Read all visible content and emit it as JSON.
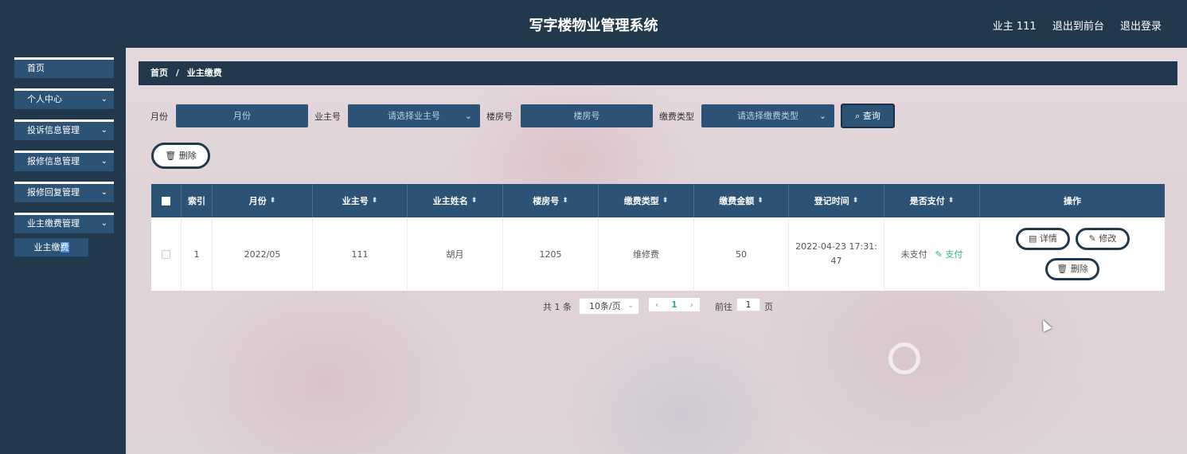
{
  "header": {
    "title": "写字楼物业管理系统",
    "user": "业主 111",
    "to_front": "退出到前台",
    "logout": "退出登录"
  },
  "sidebar": {
    "items": [
      {
        "label": "首页",
        "has_chevron": false
      },
      {
        "label": "个人中心",
        "has_chevron": true
      },
      {
        "label": "投诉信息管理",
        "has_chevron": true
      },
      {
        "label": "报修信息管理",
        "has_chevron": true
      },
      {
        "label": "报修回复管理",
        "has_chevron": true
      },
      {
        "label": "业主缴费管理",
        "has_chevron": true
      }
    ],
    "sub_item_a": "业主缴",
    "sub_item_b": "费"
  },
  "breadcrumb": {
    "home": "首页",
    "sep": "/",
    "current": "业主缴费"
  },
  "search": {
    "month_label": "月份",
    "month_placeholder": "月份",
    "owner_label": "业主号",
    "owner_placeholder": "请选择业主号",
    "room_label": "楼房号",
    "room_placeholder": "楼房号",
    "type_label": "缴费类型",
    "type_placeholder": "请选择缴费类型",
    "query_button": "查询"
  },
  "actions": {
    "delete_button": "删除"
  },
  "table": {
    "headers": [
      "",
      "索引",
      "月份",
      "业主号",
      "业主姓名",
      "楼房号",
      "缴费类型",
      "缴费金额",
      "登记时间",
      "是否支付",
      "操作"
    ],
    "row": {
      "index": "1",
      "month": "2022/05",
      "owner_no": "111",
      "owner_name": "胡月",
      "room_no": "1205",
      "fee_type": "维修费",
      "amount": "50",
      "reg_time": "2022-04-23 17:31:47",
      "paid_status": "未支付",
      "pay_link": "支付",
      "op_detail": "详情",
      "op_edit": "修改",
      "op_delete": "删除"
    }
  },
  "pagination": {
    "total": "共 1 条",
    "page_size": "10条/页",
    "current_page": "1",
    "goto_label": "前往",
    "goto_value": "1",
    "page_unit": "页"
  },
  "colors": {
    "header_bg": "#22394d",
    "accent": "#2c5376",
    "success": "#2bb673"
  }
}
